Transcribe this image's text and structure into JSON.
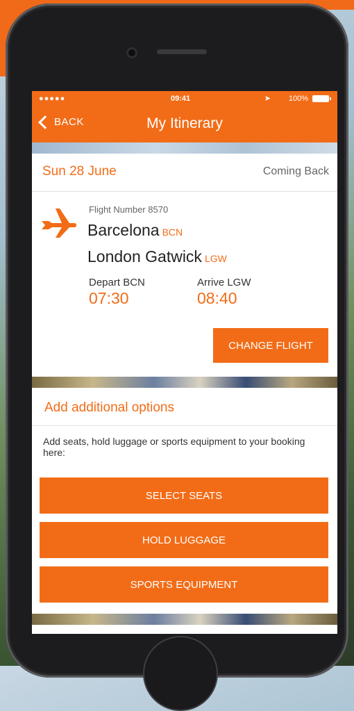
{
  "colors": {
    "accent": "#f26c17",
    "text_dark": "#222222",
    "text_muted": "#666666"
  },
  "status_bar": {
    "carrier": "●●●●● ",
    "time": "09:41",
    "battery": "100%"
  },
  "nav": {
    "back_label": "BACK",
    "title": "My Itinerary"
  },
  "trip": {
    "date": "Sun 28 June",
    "direction": "Coming Back"
  },
  "flight": {
    "icon": "plane-icon",
    "number_label": "Flight Number 8570",
    "from_city": "Barcelona",
    "from_code": "BCN",
    "to_city": "London Gatwick",
    "to_code": "LGW",
    "depart_label": "Depart BCN",
    "depart_time": "07:30",
    "arrive_label": "Arrive LGW",
    "arrive_time": "08:40",
    "change_button": "CHANGE FLIGHT"
  },
  "options": {
    "title": "Add additional options",
    "description": "Add seats, hold luggage or sports equipment to your booking here:",
    "buttons": [
      "SELECT SEATS",
      "HOLD LUGGAGE",
      "SPORTS EQUIPMENT"
    ]
  }
}
